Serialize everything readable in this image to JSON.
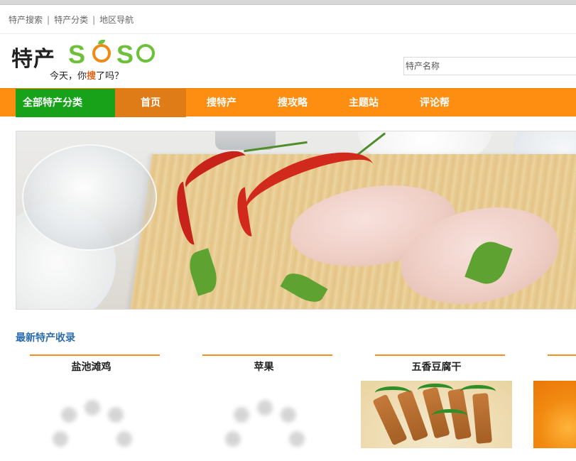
{
  "top_links": [
    "特产搜索",
    "特产分类",
    "地区导航"
  ],
  "logo": {
    "cn": "特产",
    "brand": "SOSO",
    "slogan_pre": "今天，你",
    "slogan_hl": "搜",
    "slogan_post": "了吗？"
  },
  "search": {
    "placeholder": "特产名称"
  },
  "nav": {
    "all_categories": "全部特产分类",
    "items": [
      "首页",
      "搜特产",
      "搜攻略",
      "主题站",
      "评论帮"
    ],
    "active_index": 0
  },
  "section_title": "最新特产收录",
  "products": [
    {
      "name": "盐池滩鸡",
      "image": "loading"
    },
    {
      "name": "苹果",
      "image": "loading"
    },
    {
      "name": "五香豆腐干",
      "image": "photo"
    }
  ],
  "colors": {
    "nav_bg": "#fe8e12",
    "nav_active": "#e07c18",
    "all_cat_bg": "#17a21a",
    "section_title": "#2b6cae",
    "product_bar": "#f78d1c"
  }
}
